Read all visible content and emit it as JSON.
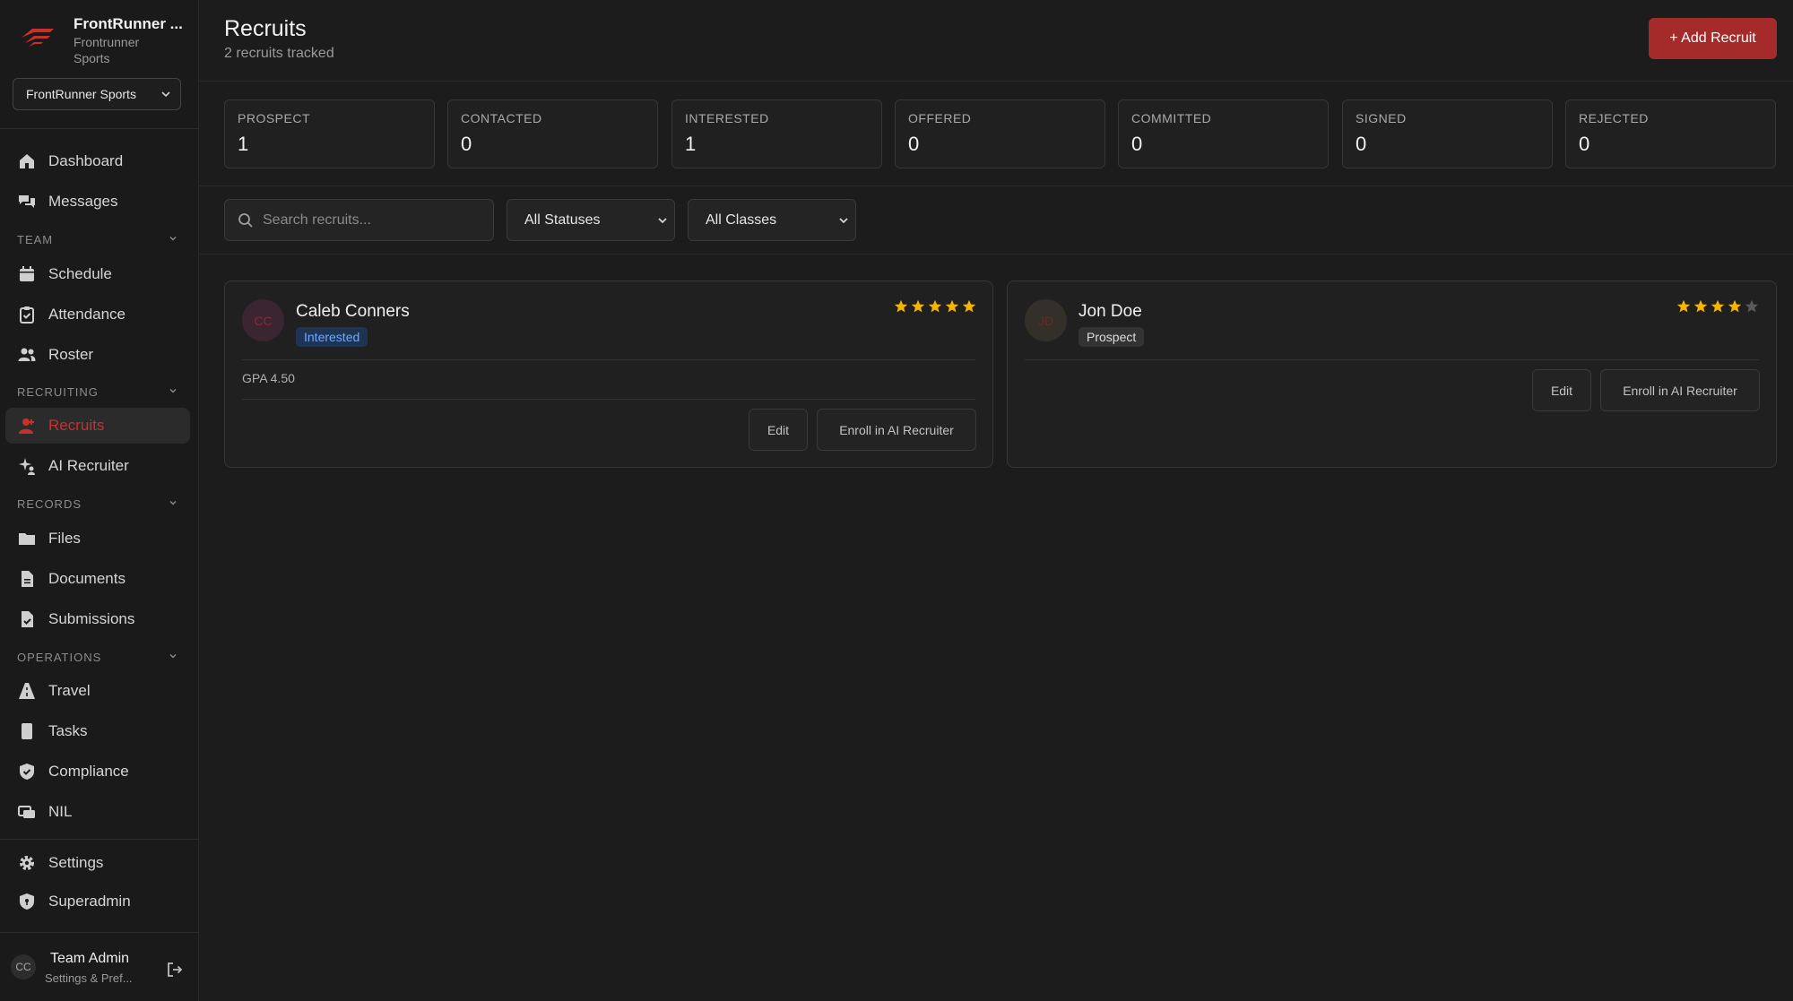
{
  "sidebar": {
    "brand_name": "FrontRunner ...",
    "brand_sub": "Frontrunner Sports",
    "org_select": "FrontRunner Sports",
    "items": {
      "dashboard": "Dashboard",
      "messages": "Messages",
      "schedule": "Schedule",
      "attendance": "Attendance",
      "roster": "Roster",
      "recruits": "Recruits",
      "ai_recruiter": "AI Recruiter",
      "files": "Files",
      "documents": "Documents",
      "submissions": "Submissions",
      "travel": "Travel",
      "tasks": "Tasks",
      "compliance": "Compliance",
      "nil": "NIL",
      "settings": "Settings",
      "superadmin": "Superadmin"
    },
    "sections": {
      "team": "TEAM",
      "recruiting": "RECRUITING",
      "records": "RECORDS",
      "operations": "OPERATIONS"
    },
    "user": {
      "initials": "CC",
      "name": "Team Admin",
      "sub": "Settings & Pref..."
    }
  },
  "header": {
    "title": "Recruits",
    "subtitle": "2 recruits tracked",
    "add_button": "+ Add Recruit"
  },
  "stats": [
    {
      "label": "PROSPECT",
      "value": "1"
    },
    {
      "label": "CONTACTED",
      "value": "0"
    },
    {
      "label": "INTERESTED",
      "value": "1"
    },
    {
      "label": "OFFERED",
      "value": "0"
    },
    {
      "label": "COMMITTED",
      "value": "0"
    },
    {
      "label": "SIGNED",
      "value": "0"
    },
    {
      "label": "REJECTED",
      "value": "0"
    }
  ],
  "filters": {
    "search_placeholder": "Search recruits...",
    "status_select": "All Statuses",
    "class_select": "All Classes"
  },
  "recruits": [
    {
      "initials": "CC",
      "name": "Caleb Conners",
      "status": "Interested",
      "rating": 5,
      "rating_max": 5,
      "gpa": "GPA 4.50",
      "edit_label": "Edit",
      "enroll_label": "Enroll in AI Recruiter"
    },
    {
      "initials": "JD",
      "name": "Jon Doe",
      "status": "Prospect",
      "rating": 4,
      "rating_max": 5,
      "edit_label": "Edit",
      "enroll_label": "Enroll in AI Recruiter"
    }
  ],
  "colors": {
    "accent": "#a52a2a",
    "active_nav": "#c9302c",
    "star_filled": "#f5b400",
    "star_empty": "#5a5a5a",
    "badge_interested_bg": "#1f3452",
    "badge_interested_fg": "#6fa8ff",
    "badge_prospect_bg": "#333333",
    "badge_prospect_fg": "#dddddd"
  }
}
